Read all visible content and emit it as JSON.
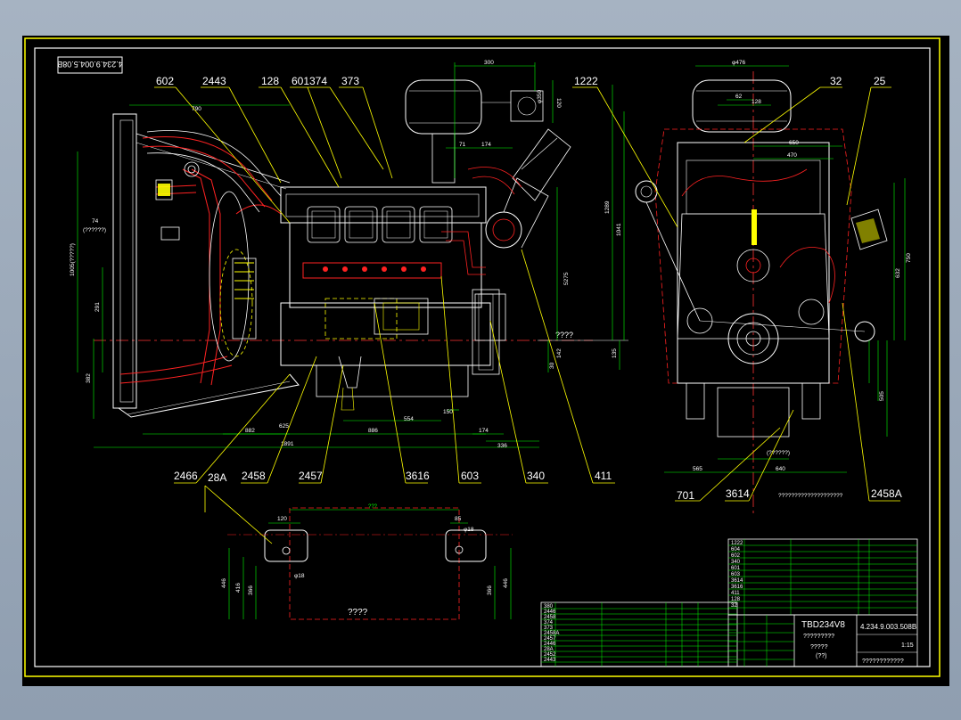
{
  "drawing": {
    "drawing_number_rotated": "4.234.9.004.5.08B",
    "callouts_top": [
      "602",
      "2443",
      "128",
      "601",
      "374",
      "373",
      "1222",
      "32",
      "25"
    ],
    "callouts_bottom": [
      "2466",
      "28A",
      "2458",
      "2457",
      "3616",
      "603",
      "340",
      "411",
      "701",
      "3614",
      "2458A"
    ],
    "side_view": {
      "dims": {
        "top_300": "300",
        "d120": "120",
        "phi350": "φ350",
        "d174_top": "174",
        "d71": "71",
        "d790": "790",
        "d74": "74",
        "q7": "(??????)",
        "d1005": "1005(?????)",
        "d291": "291",
        "d382": "382",
        "d5275": "5275",
        "d142": "142",
        "d30": "30",
        "d625": "625",
        "d554": "554",
        "d150": "150",
        "d882": "882",
        "d886": "886",
        "d174_bottom": "174",
        "d1891": "1891",
        "d336": "336",
        "qmark": "????"
      }
    },
    "front_view": {
      "dims": {
        "d476": "φ476",
        "d128": "128",
        "d62": "62",
        "d650": "650",
        "d470": "470",
        "d1289": "1289",
        "d1041": "1041",
        "d135": "135",
        "d750": "750",
        "d632": "632",
        "d565": "565",
        "d640": "640",
        "d505": "505",
        "q_long": "????????????????????",
        "q_short": "(??????)"
      }
    },
    "foot_view": {
      "label": "????",
      "dims": {
        "d120": "120",
        "d85": "85",
        "p18a": "φ18",
        "p18b": "φ18",
        "d446a": "446",
        "d416": "416",
        "d366a": "366",
        "d366b": "366",
        "d446b": "446",
        "top": "???"
      }
    },
    "title_block": {
      "model": "TBD234V8",
      "drawing_no": "4.234.9.003.508B",
      "subtitle": "?????????",
      "sub2": "?????",
      "sub3": "(??)",
      "footer": "????????????",
      "scale": "1:15",
      "left_parts": [
        "380",
        "2446",
        "2458",
        "374",
        "373",
        "2458A",
        "2457",
        "2446",
        "28A",
        "2452",
        "2443"
      ],
      "upper_parts": [
        "1222",
        "604",
        "602",
        "340",
        "601",
        "603",
        "3614",
        "3616",
        "411",
        "128",
        "32"
      ]
    }
  }
}
